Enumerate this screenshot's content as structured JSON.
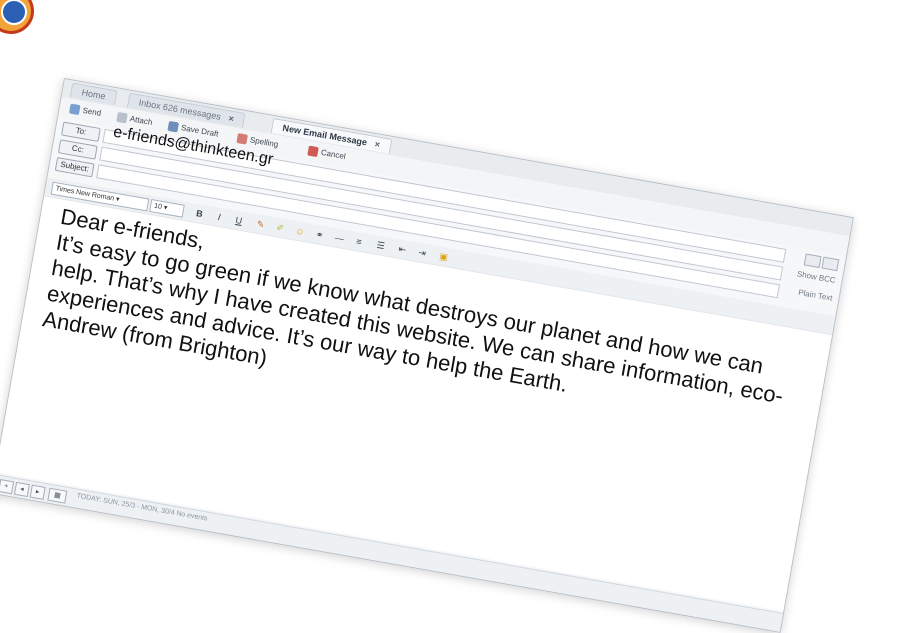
{
  "tabs": [
    {
      "label": "Home",
      "active": false
    },
    {
      "label": "Inbox 626 messages",
      "active": false
    },
    {
      "label": "New Email Message",
      "active": true
    }
  ],
  "toolbar": {
    "send": "Send",
    "attach": "Attach",
    "save_draft": "Save Draft",
    "spelling": "Spelling",
    "cancel": "Cancel"
  },
  "fields": {
    "to_label": "To:",
    "cc_label": "Cc:",
    "subject_label": "Subject:",
    "to_value": "e-friends@thinkteen.gr",
    "show_bcc": "Show BCC",
    "plain_text": "Plain Text"
  },
  "format": {
    "font": "Times New Roman",
    "size": "10"
  },
  "body": "Dear e-friends,\nIt’s easy to go green if we know what destroys our planet and how we can help. That’s why I have created this website. We can share information, eco-experiences and advice. It’s our way to help the Earth.\nAndrew (from Brighton)",
  "status": {
    "text": "TODAY: SUN, 25/3 - MON, 30/4 No events"
  }
}
